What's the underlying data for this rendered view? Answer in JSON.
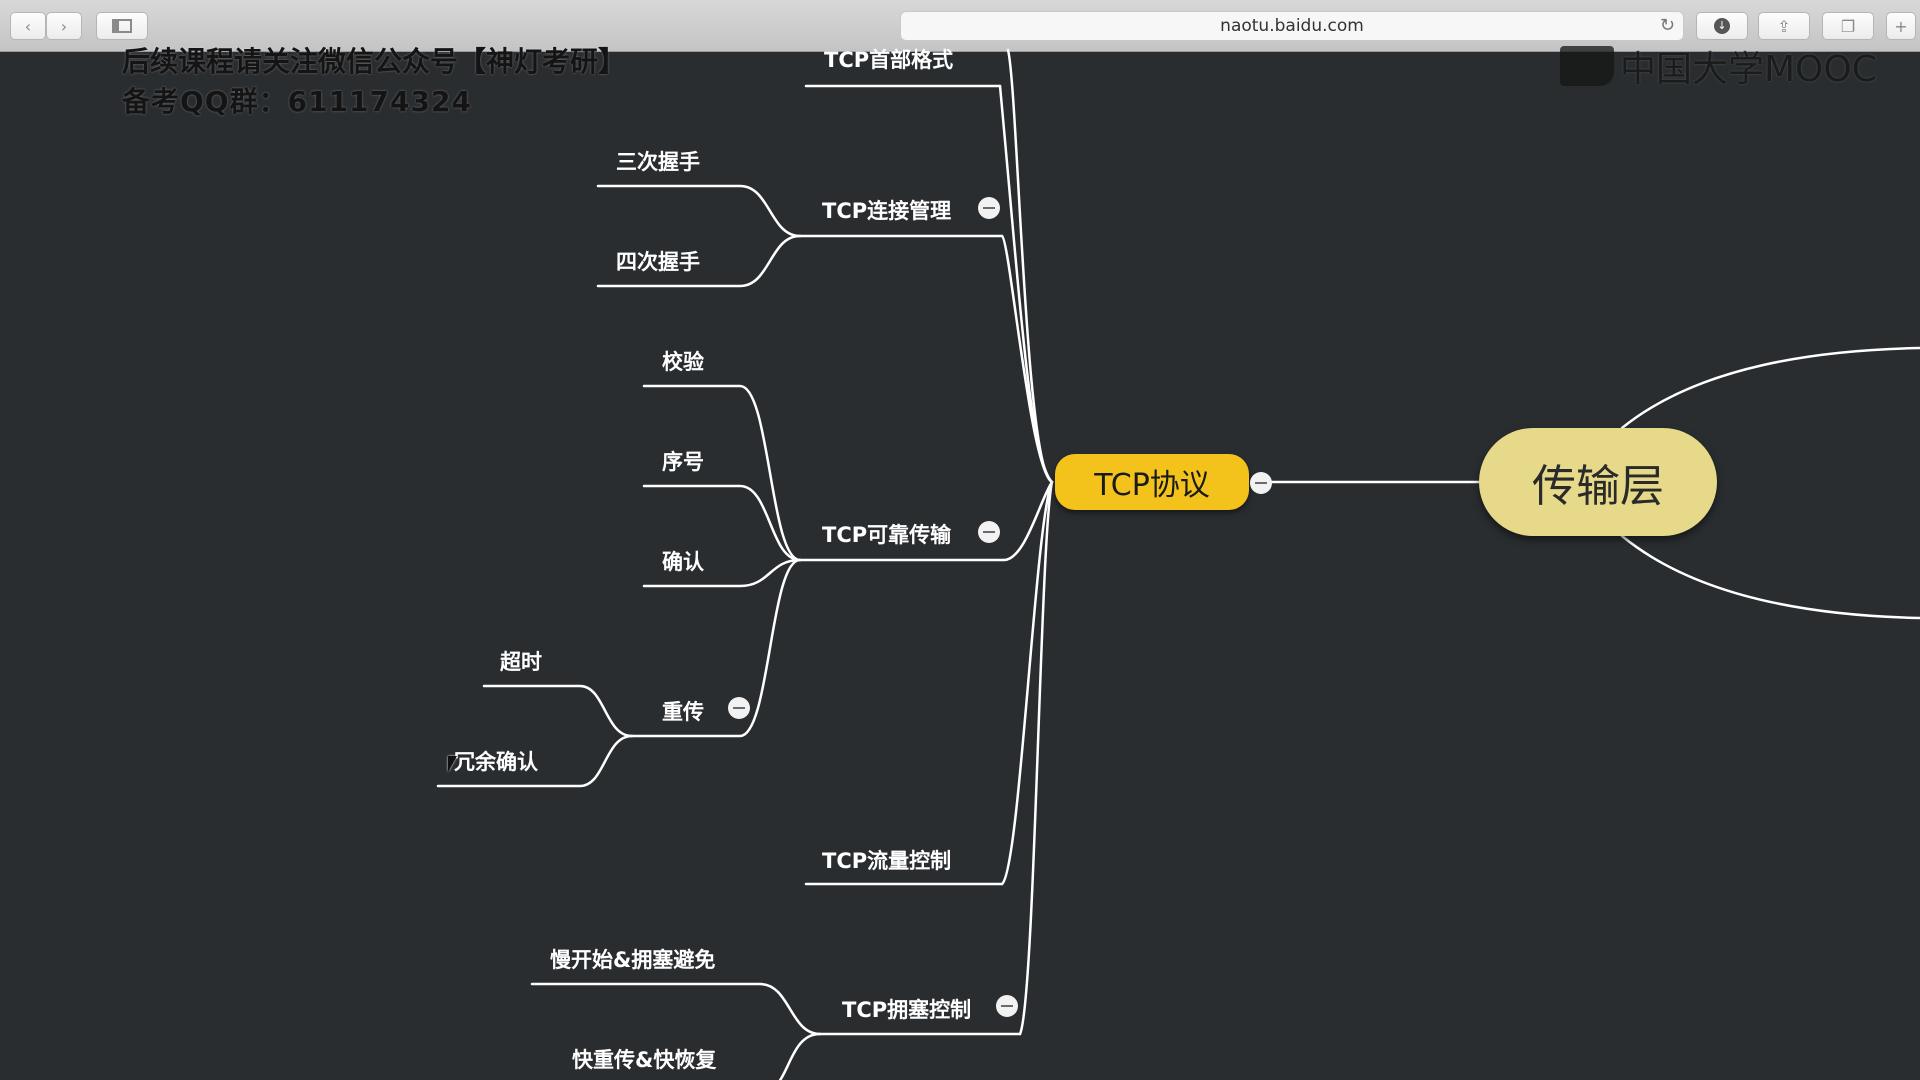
{
  "browser": {
    "url": "naotu.baidu.com",
    "icons": {
      "back": "chevron-left-icon",
      "forward": "chevron-right-icon",
      "sidebar": "sidebar-icon",
      "reload": "reload-icon",
      "download": "download-icon",
      "share": "share-icon",
      "tabs": "tabs-icon",
      "new_tab": "plus-icon"
    }
  },
  "overlay": {
    "line1": "后续课程请关注微信公众号【神灯考研】",
    "line2": "备考QQ群：611174324",
    "logo_text": "中国大学MOOC"
  },
  "mindmap": {
    "root": "传输层",
    "main": "TCP协议",
    "branches": {
      "header": "TCP首部格式",
      "connection": {
        "label": "TCP连接管理",
        "children": [
          "三次握手",
          "四次握手"
        ]
      },
      "reliable": {
        "label": "TCP可靠传输",
        "children": [
          "校验",
          "序号",
          "确认"
        ],
        "retransmit": {
          "label": "重传",
          "children": [
            "超时",
            "冗余确认"
          ]
        }
      },
      "flow": "TCP流量控制",
      "congestion": {
        "label": "TCP拥塞控制",
        "children": [
          "慢开始&拥塞避免",
          "快重传&快恢复"
        ]
      }
    }
  },
  "colors": {
    "canvas": "#2a2d30",
    "main_node": "#f4c31b",
    "root_node": "#e6d98a",
    "edge": "#ffffff"
  }
}
